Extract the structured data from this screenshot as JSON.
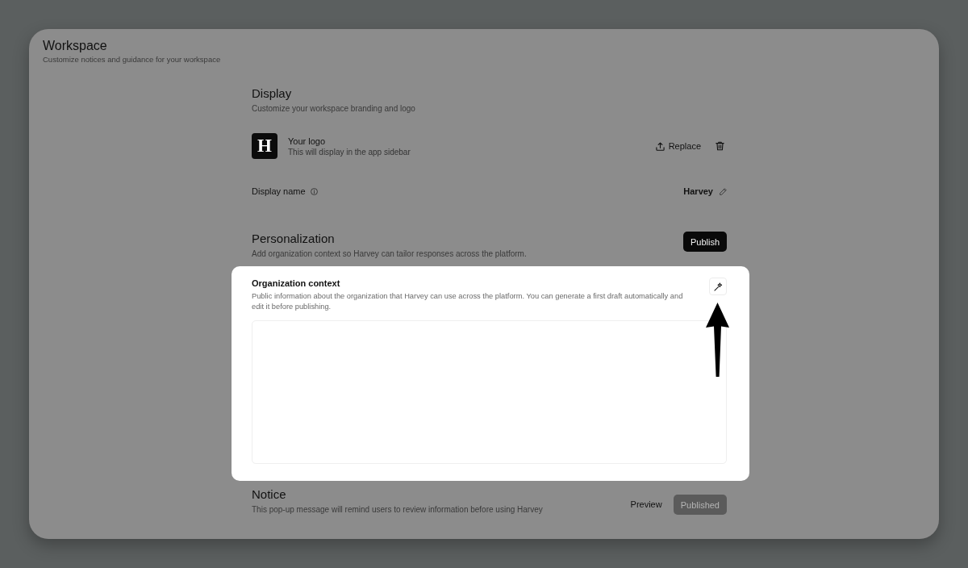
{
  "page": {
    "title": "Workspace",
    "subtitle": "Customize notices and guidance for your workspace"
  },
  "display": {
    "heading": "Display",
    "description": "Customize your workspace branding and logo",
    "logo": {
      "mark": "H",
      "label": "Your logo",
      "hint": "This will display in the app sidebar"
    },
    "replace_button": "Replace",
    "display_name": {
      "label": "Display name",
      "value": "Harvey"
    }
  },
  "personalization": {
    "heading": "Personalization",
    "description": "Add organization context so Harvey can tailor responses across the platform.",
    "publish_button": {
      "label": "Publish",
      "disabled": false
    },
    "context_panel": {
      "spotlight": true,
      "title": "Organization context",
      "description": "Public information about the organization that Harvey can use across the platform. You can generate a first draft automatically and edit it before publishing."
    }
  },
  "notice": {
    "heading": "Notice",
    "description": "This pop-up message will remind users to review information before using Harvey",
    "preview_button": "Preview",
    "publish_button": {
      "label": "Published",
      "disabled": true
    }
  }
}
